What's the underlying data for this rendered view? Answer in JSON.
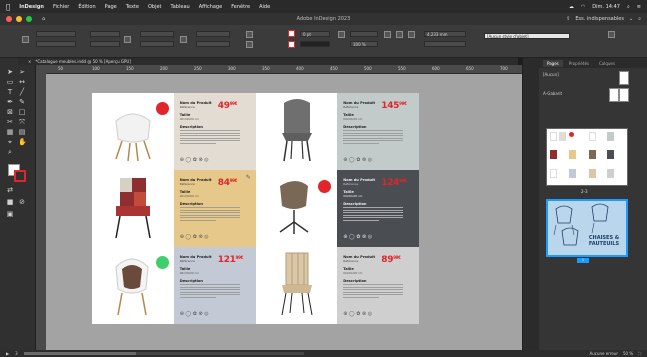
{
  "menubar": {
    "apple": "",
    "app": "InDesign",
    "items": [
      "Fichier",
      "Édition",
      "Page",
      "Texte",
      "Objet",
      "Tableau",
      "Affichage",
      "Fenêtre",
      "Aide"
    ],
    "clock": "Dim. 14:47"
  },
  "titlebar": {
    "document_title": "Adobe InDesign 2023",
    "workspace": "Ess. indispensables"
  },
  "control": {
    "zoom": "50 %",
    "stroke_weight": "0 pt",
    "fit": "4,233 mm",
    "style": "[Aucun style d'objet]",
    "percent": "100 %"
  },
  "document_tab": "*Catalogue meubles.indd @ 50 % [Aperçu GPU]",
  "ruler_ticks": [
    "50",
    "100",
    "150",
    "200",
    "250",
    "300",
    "350",
    "400",
    "450",
    "500",
    "550",
    "600",
    "650",
    "700"
  ],
  "products": [
    {
      "name": "Nom du Produit",
      "ref": "Référence",
      "price": "49",
      "cents": "99€",
      "size_label": "Taille",
      "size": "00x00x00 cm",
      "desc_label": "Description"
    },
    {
      "name": "Nom du Produit",
      "ref": "Référence",
      "price": "145",
      "cents": "99€",
      "size_label": "Taille",
      "size": "00x00x00 cm",
      "desc_label": "Description"
    },
    {
      "name": "Nom du Produit",
      "ref": "Référence",
      "price": "84",
      "cents": "99€",
      "size_label": "Taille",
      "size": "00x00x00 cm",
      "desc_label": "Description"
    },
    {
      "name": "Nom du Produit",
      "ref": "Référence",
      "price": "124",
      "cents": "99€",
      "size_label": "Taille",
      "size": "00x00x00 cm",
      "desc_label": "Description"
    },
    {
      "name": "Nom du Produit",
      "ref": "Référence",
      "price": "121",
      "cents": "99€",
      "size_label": "Taille",
      "size": "00x00x00 cm",
      "desc_label": "Description"
    },
    {
      "name": "Nom du Produit",
      "ref": "Référence",
      "price": "89",
      "cents": "99€",
      "size_label": "Taille",
      "size": "00x00x00 cm",
      "desc_label": "Description"
    }
  ],
  "icon_row": "⊕ ◯ ✿ ⊗ ◎",
  "panel": {
    "tabs": [
      "Pages",
      "Propriétés",
      "Calques"
    ],
    "none_label": "[Aucun]",
    "master_label": "A-Gabarit",
    "spread_label": "2-3",
    "cover_title": "CHAISES & FAUTEUILS",
    "selected_page": "1"
  },
  "status": {
    "page": "3",
    "errors": "Aucune erreur",
    "zoom": "50 %"
  },
  "colors": {
    "accent_red": "#e0262b",
    "selection_blue": "#1a9bff",
    "badge_green": "#3fcf6a"
  }
}
